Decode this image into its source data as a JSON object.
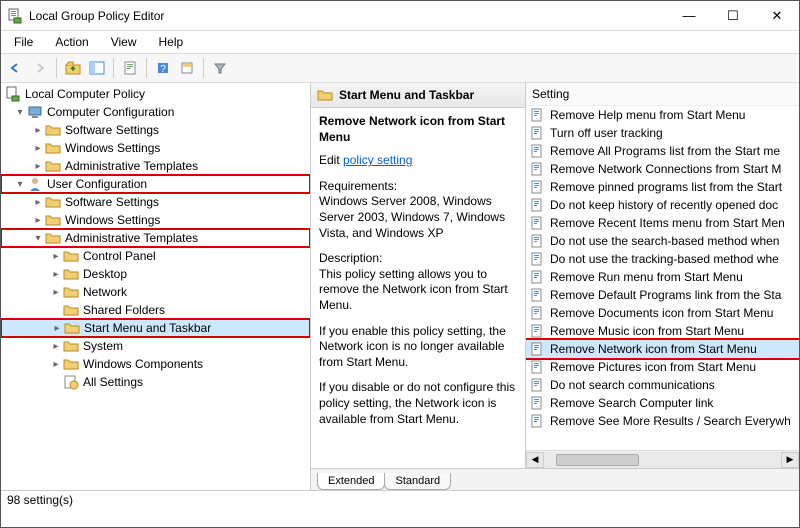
{
  "window": {
    "title": "Local Group Policy Editor",
    "min": "—",
    "max": "☐",
    "close": "✕"
  },
  "menu": {
    "items": [
      "File",
      "Action",
      "View",
      "Help"
    ]
  },
  "toolbar": {
    "back": "←",
    "fwd": "→",
    "up": "folder-up",
    "props": "props",
    "refresh": "refresh",
    "export": "export",
    "help": "?",
    "filter1": "f1",
    "filter2": "▽"
  },
  "tree": {
    "root": "Local Computer Policy",
    "cc": "Computer Configuration",
    "cc_soft": "Software Settings",
    "cc_win": "Windows Settings",
    "cc_adm": "Administrative Templates",
    "uc": "User Configuration",
    "uc_soft": "Software Settings",
    "uc_win": "Windows Settings",
    "uc_adm": "Administrative Templates",
    "cp": "Control Panel",
    "dt": "Desktop",
    "net": "Network",
    "sf": "Shared Folders",
    "smt": "Start Menu and Taskbar",
    "sys": "System",
    "wcomp": "Windows Components",
    "all": "All Settings"
  },
  "detail": {
    "header": "Start Menu and Taskbar",
    "title": "Remove Network icon from Start Menu",
    "edit_label": "Edit ",
    "edit_link": "policy setting",
    "req_label": "Requirements:",
    "req_text": "Windows Server 2008, Windows Server 2003, Windows 7, Windows Vista, and Windows XP",
    "desc_label": "Description:",
    "desc_text": "This policy setting allows you to remove the Network icon from Start Menu.",
    "p2": "If you enable this policy setting, the Network icon is no longer available from Start Menu.",
    "p3": "If you disable or do not configure this policy setting, the Network icon is available from Start Menu."
  },
  "list": {
    "header": "Setting",
    "items": [
      "Remove Help menu from Start Menu",
      "Turn off user tracking",
      "Remove All Programs list from the Start me",
      "Remove Network Connections from Start M",
      "Remove pinned programs list from the Start",
      "Do not keep history of recently opened doc",
      "Remove Recent Items menu from Start Men",
      "Do not use the search-based method when",
      "Do not use the tracking-based method whe",
      "Remove Run menu from Start Menu",
      "Remove Default Programs link from the Sta",
      "Remove Documents icon from Start Menu",
      "Remove Music icon from Start Menu",
      "Remove Network icon from Start Menu",
      "Remove Pictures icon from Start Menu",
      "Do not search communications",
      "Remove Search Computer link",
      "Remove See More Results / Search Everywh"
    ],
    "selected_index": 13
  },
  "tabs": {
    "extended": "Extended",
    "standard": "Standard"
  },
  "status": "98 setting(s)"
}
